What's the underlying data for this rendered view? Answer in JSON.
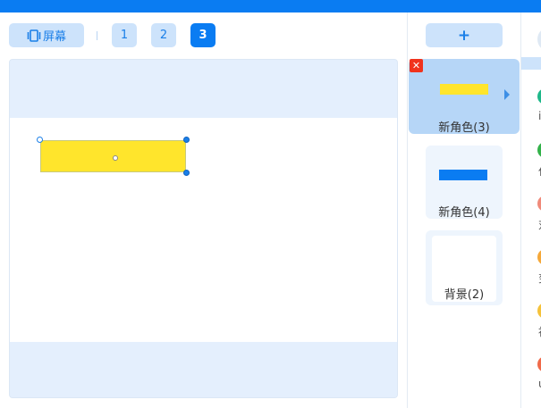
{
  "toolbar": {
    "screen_label": "屏幕",
    "pages": [
      {
        "label": "1",
        "active": false
      },
      {
        "label": "2",
        "active": false
      },
      {
        "label": "3",
        "active": true
      }
    ]
  },
  "roles": {
    "add_label": "+",
    "items": [
      {
        "label": "新角色(3)",
        "swatch": "#ffe52c",
        "selected": true,
        "close_label": "✕"
      },
      {
        "label": "新角色(4)",
        "swatch": "#0a7cf2",
        "selected": false
      },
      {
        "label": "背景(2)",
        "swatch": "#ffffff",
        "selected": false
      }
    ]
  },
  "right_panel": {
    "dots": [
      {
        "color": "#1fb88a",
        "char": "i"
      },
      {
        "color": "#33b24a",
        "char": "仆"
      },
      {
        "color": "#f08a7a",
        "char": "对"
      },
      {
        "color": "#f5a83a",
        "char": "变"
      },
      {
        "color": "#f5c23a",
        "char": "神"
      },
      {
        "color": "#f06a4a",
        "char": "u"
      }
    ]
  },
  "colors": {
    "accent": "#0a7cf2",
    "light_blue": "#cde3fb",
    "stage_band": "#e4effd",
    "sprite_yellow": "#ffe52c",
    "close_red": "#f0331d"
  }
}
